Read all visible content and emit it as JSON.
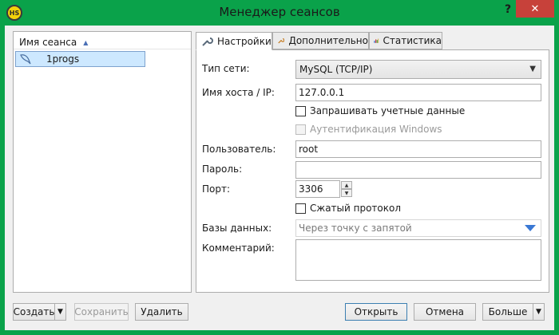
{
  "window": {
    "title": "Менеджер сеансов",
    "app_icon_text": "HS",
    "help_label": "?",
    "close_label": "✕"
  },
  "sessions": {
    "column_header": "Имя сеанса",
    "items": [
      {
        "name": "1progs",
        "selected": true
      }
    ]
  },
  "tabs": [
    {
      "label": "Настройки",
      "icon": "wrench-icon",
      "active": true
    },
    {
      "label": "Дополнительно",
      "icon": "wrench-orange-icon",
      "active": false
    },
    {
      "label": "Статистика",
      "icon": "bar-chart-icon",
      "active": false
    }
  ],
  "settings": {
    "network_type_label": "Тип сети:",
    "network_type_value": "MySQL (TCP/IP)",
    "host_label": "Имя хоста / IP:",
    "host_value": "127.0.0.1",
    "prompt_credentials_label": "Запрашивать учетные данные",
    "windows_auth_label": "Аутентификация Windows",
    "user_label": "Пользователь:",
    "user_value": "root",
    "password_label": "Пароль:",
    "password_value": "",
    "port_label": "Порт:",
    "port_value": "3306",
    "compressed_label": "Сжатый протокол",
    "databases_label": "Базы данных:",
    "databases_placeholder": "Через точку с запятой",
    "comment_label": "Комментарий:",
    "comment_value": ""
  },
  "buttons": {
    "create": "Создать",
    "save": "Сохранить",
    "delete": "Удалить",
    "open": "Открыть",
    "cancel": "Отмена",
    "more": "Больше"
  }
}
